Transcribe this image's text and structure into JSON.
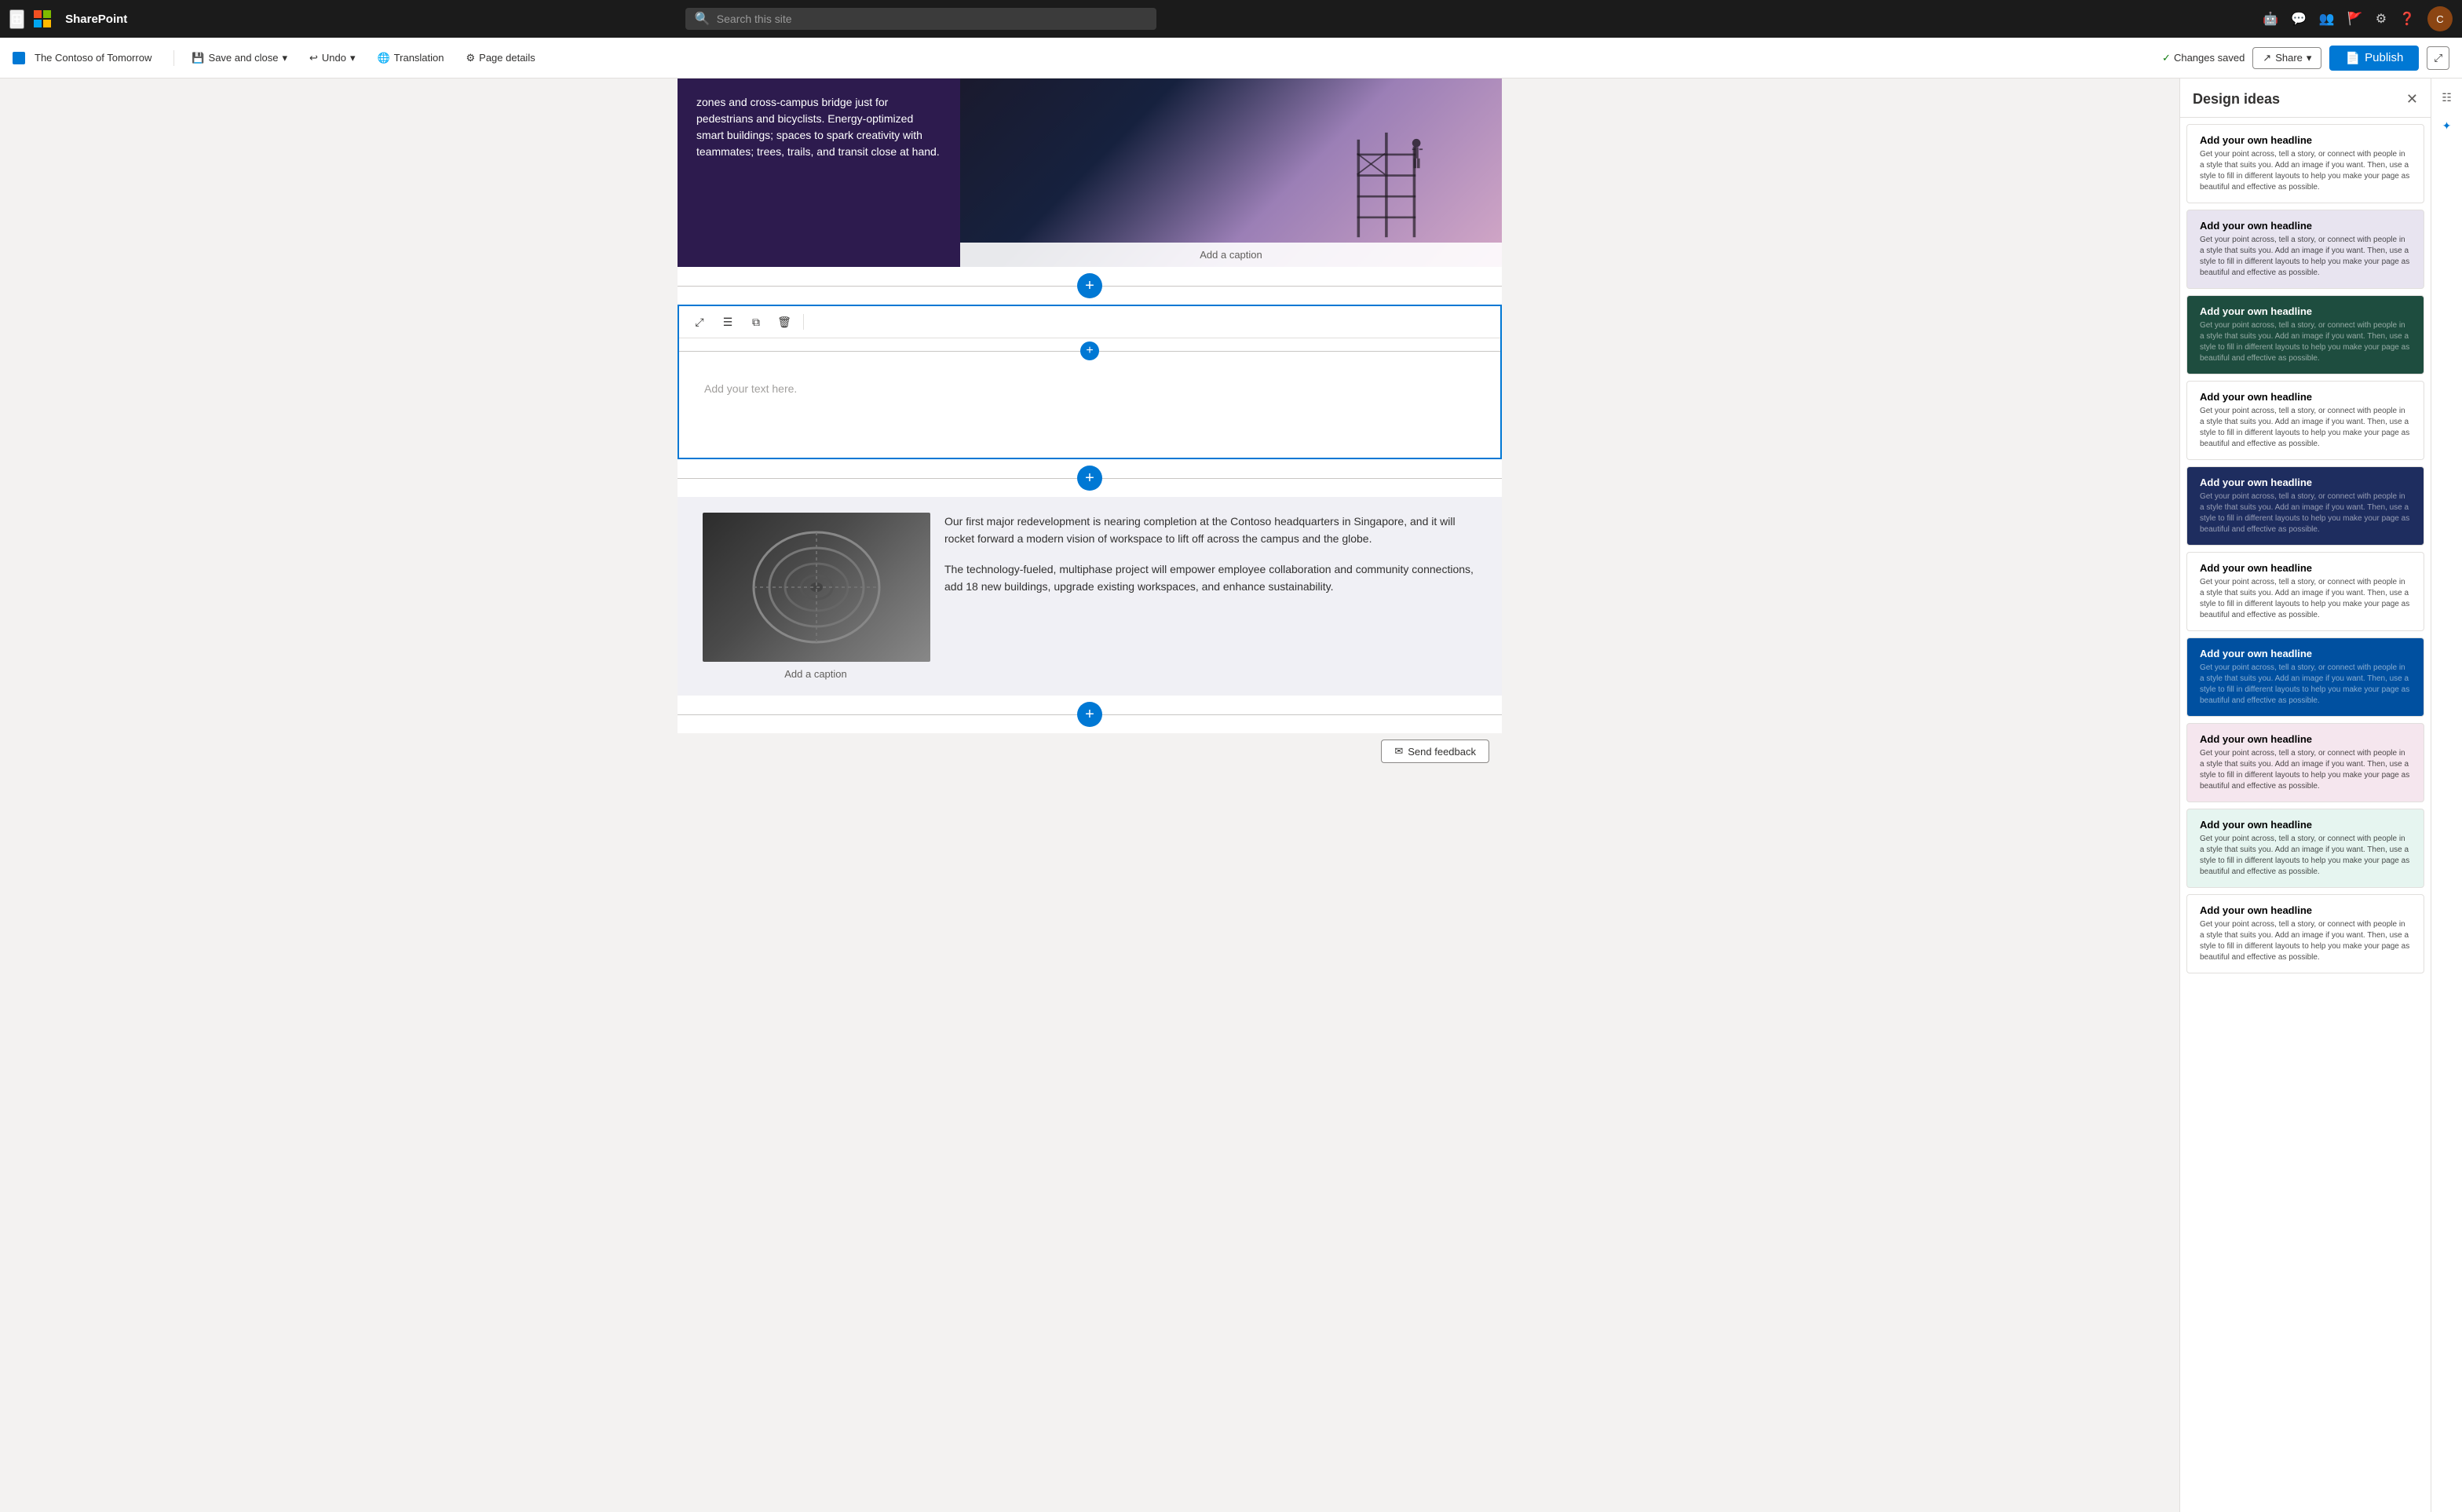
{
  "topNav": {
    "appName": "SharePoint",
    "search": {
      "placeholder": "Search this site"
    }
  },
  "toolbar": {
    "pageTitle": "The Contoso of Tomorrow",
    "saveAndClose": "Save and close",
    "undo": "Undo",
    "translation": "Translation",
    "pageDetails": "Page details",
    "changesSaved": "Changes saved",
    "share": "Share",
    "publish": "Publish"
  },
  "designIdeas": {
    "title": "Design ideas",
    "cards": [
      {
        "id": 1,
        "style": "white",
        "headline": "Add your own headline",
        "body": "Get your point across, tell a story, or connect with people in a style that suits you. Add an image if you want. Then, use a style to fill in different layouts to help you make your page as beautiful and effective as possible."
      },
      {
        "id": 2,
        "style": "lavender",
        "headline": "Add your own headline",
        "body": "Get your point across, tell a story, or connect with people in a style that suits you. Add an image if you want. Then, use a style to fill in different layouts to help you make your page as beautiful and effective as possible."
      },
      {
        "id": 3,
        "style": "dark-green",
        "headline": "Add your own headline",
        "body": "Get your point across, tell a story, or connect with people in a style that suits you. Add an image if you want. Then, use a style to fill in different layouts to help you make your page as beautiful and effective as possible."
      },
      {
        "id": 4,
        "style": "light",
        "headline": "Add your own headline",
        "body": "Get your point across, tell a story, or connect with people in a style that suits you. Add an image if you want. Then, use a style to fill in different layouts to help you make your page as beautiful and effective as possible."
      },
      {
        "id": 5,
        "style": "navy",
        "headline": "Add your own headline",
        "body": "Get your point across, tell a story, or connect with people in a style that suits you. Add an image if you want. Then, use a style to fill in different layouts to help you make your page as beautiful and effective as possible."
      },
      {
        "id": 6,
        "style": "plain",
        "headline": "Add your own headline",
        "body": "Get your point across, tell a story, or connect with people in a style that suits you. Add an image if you want. Then, use a style to fill in different layouts to help you make your page as beautiful and effective as possible."
      },
      {
        "id": 7,
        "style": "blue",
        "headline": "Add your own headline",
        "body": "Get your point across, tell a story, or connect with people in a style that suits you. Add an image if you want. Then, use a style to fill in different layouts to help you make your page as beautiful and effective as possible."
      },
      {
        "id": 8,
        "style": "pink",
        "headline": "Add your own headline",
        "body": "Get your point across, tell a story, or connect with people in a style that suits you. Add an image if you want. Then, use a style to fill in different layouts to help you make your page as beautiful and effective as possible."
      },
      {
        "id": 9,
        "style": "mint",
        "headline": "Add your own headline",
        "body": "Get your point across, tell a story, or connect with people in a style that suits you. Add an image if you want. Then, use a style to fill in different layouts to help you make your page as beautiful and effective as possible."
      },
      {
        "id": 10,
        "style": "white",
        "headline": "Add your own headline",
        "body": "Get your point across, tell a story, or connect with people in a style that suits you. Add an image if you want. Then, use a style to fill in different layouts to help you make your page as beautiful and effective as possible."
      }
    ]
  },
  "pageText": {
    "topLeftContent": "zones and cross-campus bridge just for pedestrians and bicyclists. Energy-optimized smart buildings; spaces to spark creativity with teammates; trees, trails, and transit close at hand.",
    "imageCaption1": "Add a caption",
    "textEditorPlaceholder": "Add your text here.",
    "imageCaption2": "Add a caption",
    "paragraph1": "Our first major redevelopment is nearing completion at the Contoso headquarters in Singapore, and it will rocket forward a modern vision of workspace to lift off across the campus and the globe.",
    "paragraph2": "The technology-fueled, multiphase project will empower employee collaboration and community connections, add 18 new buildings, upgrade existing workspaces, and enhance sustainability.",
    "sendFeedback": "Send feedback"
  },
  "editorTools": [
    {
      "name": "move",
      "icon": "✥",
      "label": "Move"
    },
    {
      "name": "settings",
      "icon": "≡",
      "label": "Settings"
    },
    {
      "name": "duplicate",
      "icon": "⧉",
      "label": "Duplicate"
    },
    {
      "name": "delete",
      "icon": "🗑",
      "label": "Delete"
    }
  ]
}
